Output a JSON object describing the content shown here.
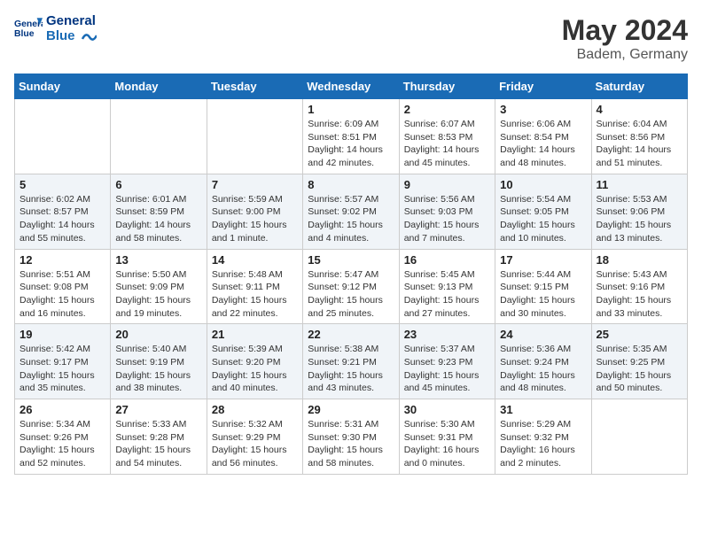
{
  "header": {
    "logo_line1": "General",
    "logo_line2": "Blue",
    "month": "May 2024",
    "location": "Badem, Germany"
  },
  "weekdays": [
    "Sunday",
    "Monday",
    "Tuesday",
    "Wednesday",
    "Thursday",
    "Friday",
    "Saturday"
  ],
  "weeks": [
    [
      {
        "day": "",
        "info": ""
      },
      {
        "day": "",
        "info": ""
      },
      {
        "day": "",
        "info": ""
      },
      {
        "day": "1",
        "info": "Sunrise: 6:09 AM\nSunset: 8:51 PM\nDaylight: 14 hours\nand 42 minutes."
      },
      {
        "day": "2",
        "info": "Sunrise: 6:07 AM\nSunset: 8:53 PM\nDaylight: 14 hours\nand 45 minutes."
      },
      {
        "day": "3",
        "info": "Sunrise: 6:06 AM\nSunset: 8:54 PM\nDaylight: 14 hours\nand 48 minutes."
      },
      {
        "day": "4",
        "info": "Sunrise: 6:04 AM\nSunset: 8:56 PM\nDaylight: 14 hours\nand 51 minutes."
      }
    ],
    [
      {
        "day": "5",
        "info": "Sunrise: 6:02 AM\nSunset: 8:57 PM\nDaylight: 14 hours\nand 55 minutes."
      },
      {
        "day": "6",
        "info": "Sunrise: 6:01 AM\nSunset: 8:59 PM\nDaylight: 14 hours\nand 58 minutes."
      },
      {
        "day": "7",
        "info": "Sunrise: 5:59 AM\nSunset: 9:00 PM\nDaylight: 15 hours\nand 1 minute."
      },
      {
        "day": "8",
        "info": "Sunrise: 5:57 AM\nSunset: 9:02 PM\nDaylight: 15 hours\nand 4 minutes."
      },
      {
        "day": "9",
        "info": "Sunrise: 5:56 AM\nSunset: 9:03 PM\nDaylight: 15 hours\nand 7 minutes."
      },
      {
        "day": "10",
        "info": "Sunrise: 5:54 AM\nSunset: 9:05 PM\nDaylight: 15 hours\nand 10 minutes."
      },
      {
        "day": "11",
        "info": "Sunrise: 5:53 AM\nSunset: 9:06 PM\nDaylight: 15 hours\nand 13 minutes."
      }
    ],
    [
      {
        "day": "12",
        "info": "Sunrise: 5:51 AM\nSunset: 9:08 PM\nDaylight: 15 hours\nand 16 minutes."
      },
      {
        "day": "13",
        "info": "Sunrise: 5:50 AM\nSunset: 9:09 PM\nDaylight: 15 hours\nand 19 minutes."
      },
      {
        "day": "14",
        "info": "Sunrise: 5:48 AM\nSunset: 9:11 PM\nDaylight: 15 hours\nand 22 minutes."
      },
      {
        "day": "15",
        "info": "Sunrise: 5:47 AM\nSunset: 9:12 PM\nDaylight: 15 hours\nand 25 minutes."
      },
      {
        "day": "16",
        "info": "Sunrise: 5:45 AM\nSunset: 9:13 PM\nDaylight: 15 hours\nand 27 minutes."
      },
      {
        "day": "17",
        "info": "Sunrise: 5:44 AM\nSunset: 9:15 PM\nDaylight: 15 hours\nand 30 minutes."
      },
      {
        "day": "18",
        "info": "Sunrise: 5:43 AM\nSunset: 9:16 PM\nDaylight: 15 hours\nand 33 minutes."
      }
    ],
    [
      {
        "day": "19",
        "info": "Sunrise: 5:42 AM\nSunset: 9:17 PM\nDaylight: 15 hours\nand 35 minutes."
      },
      {
        "day": "20",
        "info": "Sunrise: 5:40 AM\nSunset: 9:19 PM\nDaylight: 15 hours\nand 38 minutes."
      },
      {
        "day": "21",
        "info": "Sunrise: 5:39 AM\nSunset: 9:20 PM\nDaylight: 15 hours\nand 40 minutes."
      },
      {
        "day": "22",
        "info": "Sunrise: 5:38 AM\nSunset: 9:21 PM\nDaylight: 15 hours\nand 43 minutes."
      },
      {
        "day": "23",
        "info": "Sunrise: 5:37 AM\nSunset: 9:23 PM\nDaylight: 15 hours\nand 45 minutes."
      },
      {
        "day": "24",
        "info": "Sunrise: 5:36 AM\nSunset: 9:24 PM\nDaylight: 15 hours\nand 48 minutes."
      },
      {
        "day": "25",
        "info": "Sunrise: 5:35 AM\nSunset: 9:25 PM\nDaylight: 15 hours\nand 50 minutes."
      }
    ],
    [
      {
        "day": "26",
        "info": "Sunrise: 5:34 AM\nSunset: 9:26 PM\nDaylight: 15 hours\nand 52 minutes."
      },
      {
        "day": "27",
        "info": "Sunrise: 5:33 AM\nSunset: 9:28 PM\nDaylight: 15 hours\nand 54 minutes."
      },
      {
        "day": "28",
        "info": "Sunrise: 5:32 AM\nSunset: 9:29 PM\nDaylight: 15 hours\nand 56 minutes."
      },
      {
        "day": "29",
        "info": "Sunrise: 5:31 AM\nSunset: 9:30 PM\nDaylight: 15 hours\nand 58 minutes."
      },
      {
        "day": "30",
        "info": "Sunrise: 5:30 AM\nSunset: 9:31 PM\nDaylight: 16 hours\nand 0 minutes."
      },
      {
        "day": "31",
        "info": "Sunrise: 5:29 AM\nSunset: 9:32 PM\nDaylight: 16 hours\nand 2 minutes."
      },
      {
        "day": "",
        "info": ""
      }
    ]
  ]
}
